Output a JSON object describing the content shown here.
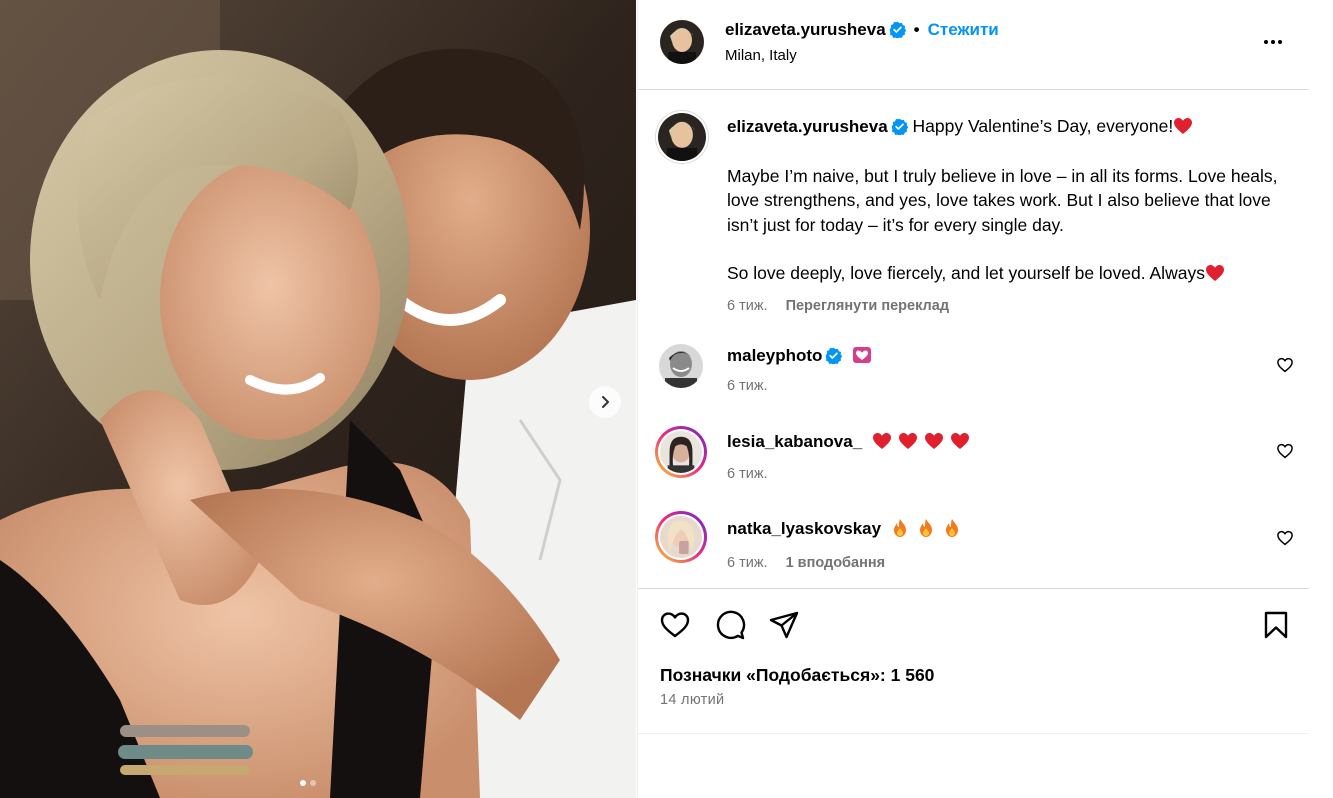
{
  "post": {
    "username": "elizaveta.yurusheva",
    "follow_label": "Стежити",
    "separator": "•",
    "location": "Milan, Italy"
  },
  "caption": {
    "username": "elizaveta.yurusheva",
    "line1": "Happy Valentine’s Day, everyone!",
    "paragraph2": "Maybe I’m naive, but I truly believe in love – in all its forms. Love heals, love strengthens, and yes, love takes work. But I also believe that love isn’t just for today – it’s for every single day.",
    "paragraph3": "So love deeply, love fiercely, and let yourself be loved. Always",
    "time": "6 тиж.",
    "translate_label": "Переглянути переклад"
  },
  "comments": [
    {
      "username": "maleyphoto",
      "verified": true,
      "emoji": "💟",
      "time": "6 тиж.",
      "likes_label": ""
    },
    {
      "username": "lesia_kabanova_",
      "verified": false,
      "emoji": "heart x4",
      "time": "6 тиж.",
      "likes_label": ""
    },
    {
      "username": "natka_lyaskovskay",
      "verified": false,
      "emoji": "fire x3",
      "time": "6 тиж.",
      "likes_label": "1 вподобання"
    }
  ],
  "footer": {
    "likes_text": "Позначки «Подобається»: 1 560",
    "date": "14 лютий"
  },
  "icons": {
    "verified": "verified-badge-icon",
    "more": "more-options-icon",
    "next": "chevron-right-icon",
    "like": "heart-outline-icon",
    "comment": "comment-bubble-icon",
    "share": "paper-plane-icon",
    "save": "bookmark-icon"
  },
  "colors": {
    "link_blue": "#0095f6",
    "verified_blue": "#0095f6",
    "muted": "#737373",
    "emoji_red": "#e0202e"
  },
  "carousel": {
    "slides": 2,
    "active": 1
  }
}
